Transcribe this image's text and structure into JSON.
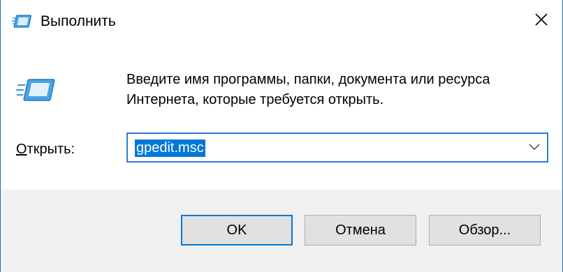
{
  "window": {
    "title": "Выполнить",
    "accent_color": "#0078d7"
  },
  "icons": {
    "title": "run-dialog-icon",
    "main": "run-dialog-icon",
    "close": "close-icon",
    "dropdown": "chevron-down-icon"
  },
  "description": {
    "line1": "Введите имя программы, папки, документа или ресурса",
    "line2": "Интернета, которые требуется открыть."
  },
  "open_field": {
    "label_accel": "О",
    "label_rest": "ткрыть:",
    "value": "gpedit.msc"
  },
  "buttons": {
    "ok": "OK",
    "cancel": "Отмена",
    "browse": "Обзор..."
  }
}
